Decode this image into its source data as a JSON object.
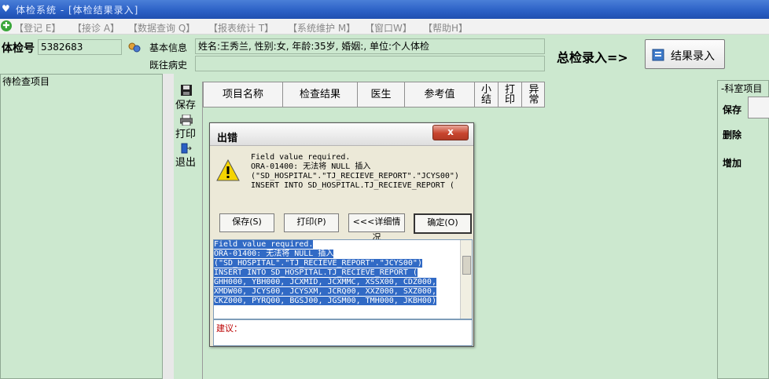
{
  "window": {
    "title": "体检系统 - [体检结果录入]"
  },
  "menu": [
    "【登记 E】",
    "【接诊 A】",
    "【数据查询 Q】",
    "【报表统计 T】",
    "【系统维护 M】",
    "【窗口W】",
    "【帮助H】"
  ],
  "header": {
    "exam_no_label": "体检号",
    "exam_no_value": "5382683",
    "basic_info_label": "基本信息",
    "basic_info_value": "姓名:王秀兰, 性别:女, 年龄:35岁, 婚姻:, 单位:个人体检",
    "history_label": "既往病史",
    "history_value": "",
    "summary_label": "总检录入=>",
    "result_button": "结果录入"
  },
  "left_panel": {
    "title": "待检查项目"
  },
  "toolbar": {
    "save": "保存",
    "print": "打印",
    "exit": "退出"
  },
  "grid": {
    "columns": [
      "项目名称",
      "检查结果",
      "医生",
      "参考值",
      "小结",
      "打印",
      "异常"
    ]
  },
  "right_panel": {
    "title": "-科室项目",
    "buttons": [
      "保存",
      "删除",
      "增加"
    ]
  },
  "dialog": {
    "title": "出错",
    "close": "x",
    "message": "Field value required.\nORA-01400: 无法将 NULL 插入\n(\"SD_HOSPITAL\".\"TJ_RECIEVE_REPORT\".\"JCYS00\")\nINSERT INTO SD_HOSPITAL.TJ_RECIEVE_REPORT (",
    "buttons": {
      "save": "保存(S)",
      "print": "打印(P)",
      "details": "<<<详细情况",
      "ok": "确定(O)"
    },
    "detail_lines": [
      "Field value required.",
      "ORA-01400: 无法将 NULL 插入",
      "(\"SD_HOSPITAL\".\"TJ_RECIEVE_REPORT\".\"JCYS00\")",
      "INSERT INTO SD_HOSPITAL.TJ_RECIEVE_REPORT (",
      "GHH000, YBH000, JCXMID, JCXMMC, XSSX00, CDZ000,",
      "XMDW00, JCYS00, JCYSXM, JCRQ00, XXZ000, SXZ000,",
      "CKZ000, PYRQ00, BGSJ00, JGSM00, TMH000, JKBH00)"
    ],
    "suggestion_label": "建议："
  }
}
